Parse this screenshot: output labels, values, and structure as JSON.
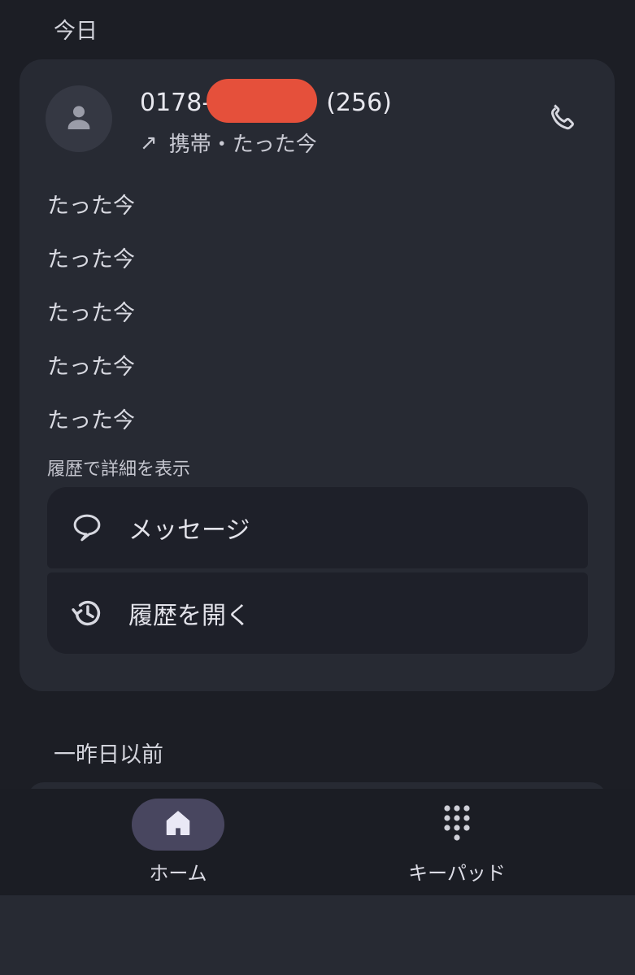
{
  "sections": {
    "today": "今日",
    "older": "一昨日以前"
  },
  "call_card": {
    "number_prefix": "0178-",
    "number_suffix": "(256)",
    "direction_icon": "outgoing-arrow-icon",
    "direction_glyph": "↗",
    "subtitle": "携帯・たった今",
    "history": [
      "たった今",
      "たった今",
      "たった今",
      "たった今",
      "たった今"
    ],
    "detail_label": "履歴で詳細を表示",
    "actions": {
      "message_label": "メッセージ",
      "open_history_label": "履歴を開く"
    }
  },
  "bottom_nav": {
    "home_label": "ホーム",
    "keypad_label": "キーパッド"
  },
  "colors": {
    "background": "#1c1e25",
    "card": "#272a33",
    "action_button": "#1e2029",
    "nav_active_pill": "#48465f",
    "redaction": "#e5503b"
  }
}
